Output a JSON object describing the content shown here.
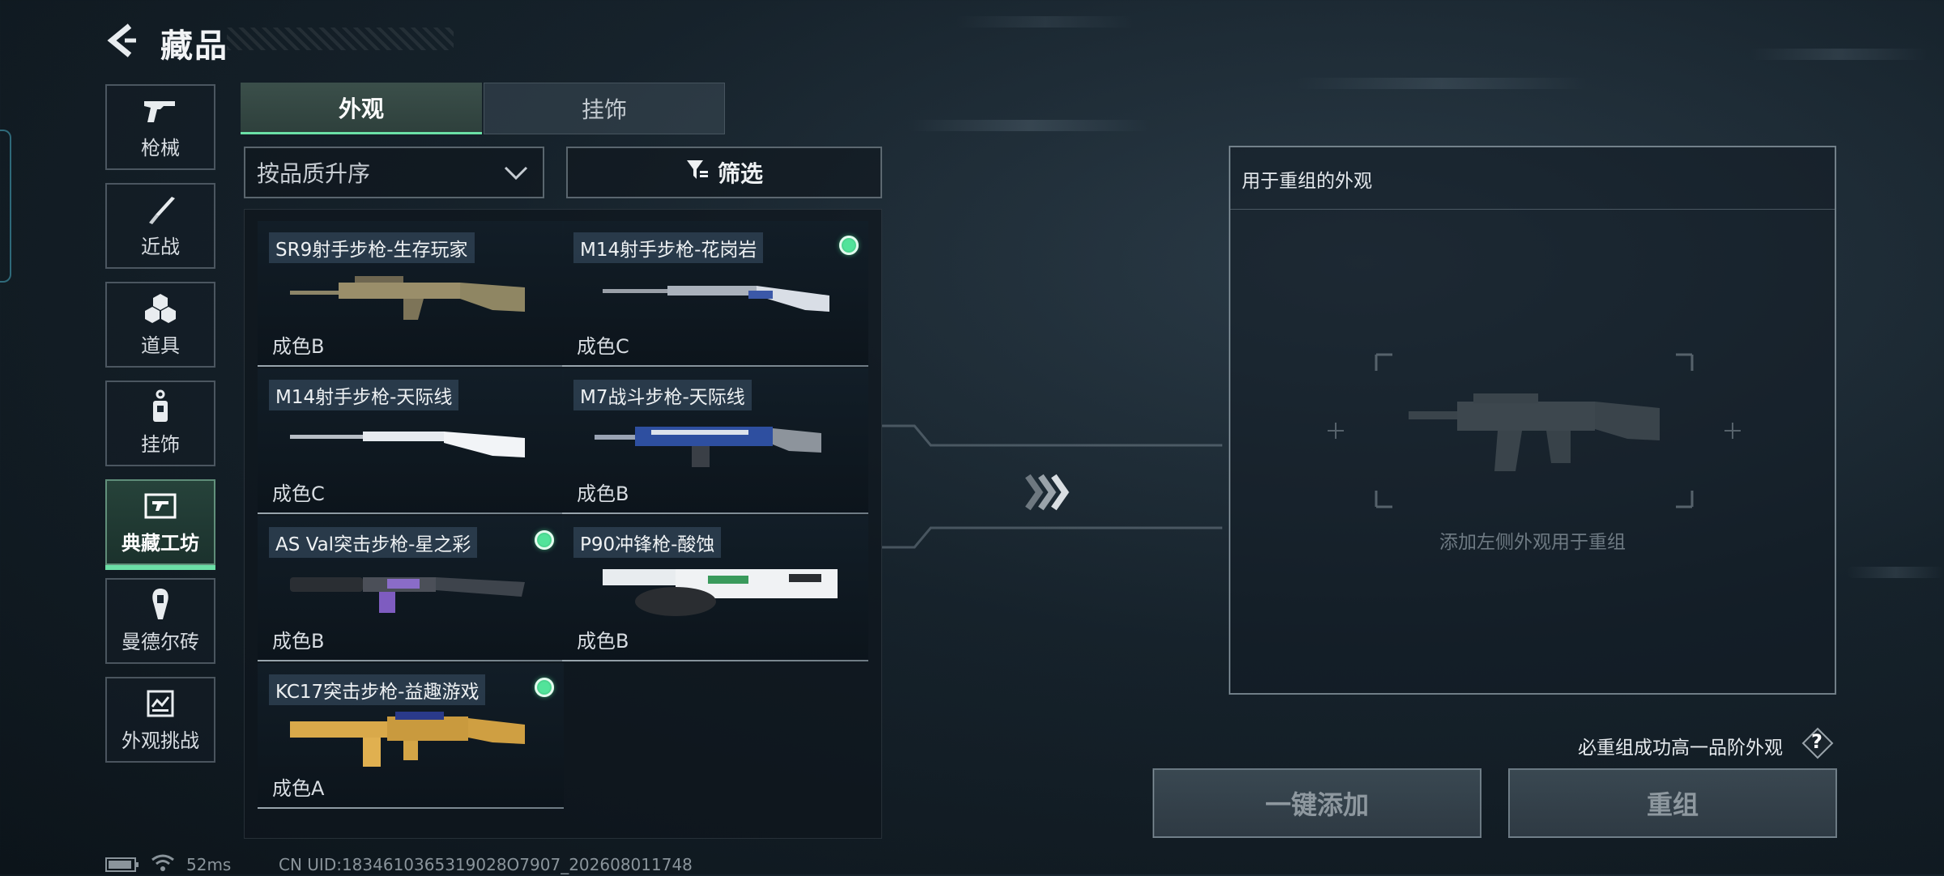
{
  "header": {
    "title": "藏品",
    "back_icon": "back-arrow-icon"
  },
  "sidebar": {
    "items": [
      {
        "label": "枪械",
        "icon": "pistol-icon"
      },
      {
        "label": "近战",
        "icon": "knife-icon"
      },
      {
        "label": "道具",
        "icon": "grenades-icon"
      },
      {
        "label": "挂饰",
        "icon": "charm-icon"
      },
      {
        "label": "典藏工坊",
        "icon": "workshop-icon",
        "active": true
      },
      {
        "label": "曼德尔砖",
        "icon": "mandel-brick-icon"
      },
      {
        "label": "外观挑战",
        "icon": "skin-challenge-icon"
      }
    ]
  },
  "tabs": [
    {
      "label": "外观",
      "active": true
    },
    {
      "label": "挂饰",
      "active": false
    }
  ],
  "sort": {
    "value": "按品质升序"
  },
  "filter": {
    "label": "筛选"
  },
  "items": [
    {
      "name": "SR9射手步枪-生存玩家",
      "quality": "成色B",
      "marked": false
    },
    {
      "name": "M14射手步枪-花岗岩",
      "quality": "成色C",
      "marked": true
    },
    {
      "name": "M14射手步枪-天际线",
      "quality": "成色C",
      "marked": false
    },
    {
      "name": "M7战斗步枪-天际线",
      "quality": "成色B",
      "marked": false
    },
    {
      "name": "AS Val突击步枪-星之彩",
      "quality": "成色B",
      "marked": true
    },
    {
      "name": "P90冲锋枪-酸蚀",
      "quality": "成色B",
      "marked": false
    },
    {
      "name": "KC17突击步枪-益趣游戏",
      "quality": "成色A",
      "marked": true
    }
  ],
  "reassemble_panel": {
    "title": "用于重组的外观",
    "hint": "添加左侧外观用于重组"
  },
  "note": "必重组成功高一品阶外观",
  "help_label": "?",
  "buttons": {
    "quick_add": "一键添加",
    "reassemble": "重组"
  },
  "status": {
    "ping": "52ms",
    "uid": "CN UID:1834610365319028O7907_202608011748"
  },
  "colors": {
    "accent": "#6be0a6",
    "marked_dot": "#4cd690"
  }
}
